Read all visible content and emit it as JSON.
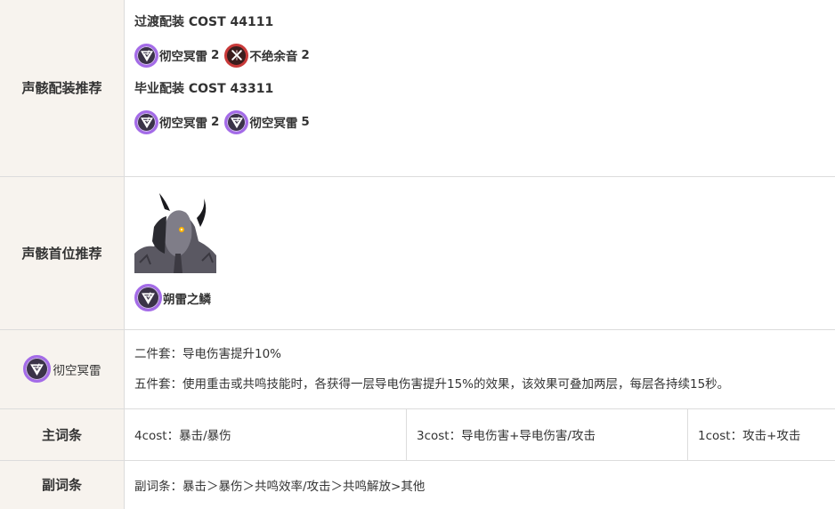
{
  "rows": {
    "echo_setup": {
      "label": "声骸配装推荐",
      "transition_title": "过渡配装 COST 44111",
      "transition_echoes": [
        {
          "name": "彻空冥雷",
          "count": "2",
          "icon": "void-thunder-icon"
        },
        {
          "name": "不绝余音",
          "count": "2",
          "icon": "lingering-tunes-icon"
        }
      ],
      "final_title": "毕业配装 COST 43311",
      "final_echoes": [
        {
          "name": "彻空冥雷",
          "count": "2",
          "icon": "void-thunder-icon"
        },
        {
          "name": "彻空冥雷",
          "count": "5",
          "icon": "void-thunder-icon"
        }
      ]
    },
    "main_echo": {
      "label": "声骸首位推荐",
      "echo_name": "朔雷之鳞",
      "portrait_icon": "tempest-mephis-portrait"
    },
    "set_effect": {
      "set_name": "彻空冥雷",
      "two_piece": "二件套：导电伤害提升10%",
      "five_piece": "五件套：使用重击或共鸣技能时，各获得一层导电伤害提升15%的效果，该效果可叠加两层，每层各持续15秒。"
    },
    "main_stats": {
      "label": "主词条",
      "cost4": "4cost：暴击/暴伤",
      "cost3": "3cost：导电伤害+导电伤害/攻击",
      "cost1": "1cost：攻击+攻击"
    },
    "sub_stats": {
      "label": "副词条",
      "text": "副词条：暴击＞暴伤＞共鸣效率/攻击＞共鸣解放>其他"
    }
  },
  "colors": {
    "label_bg": "#f7f3ee",
    "border": "#dcdcdc",
    "purple_ring": "#a46be8",
    "red_ring": "#c93a3a"
  }
}
